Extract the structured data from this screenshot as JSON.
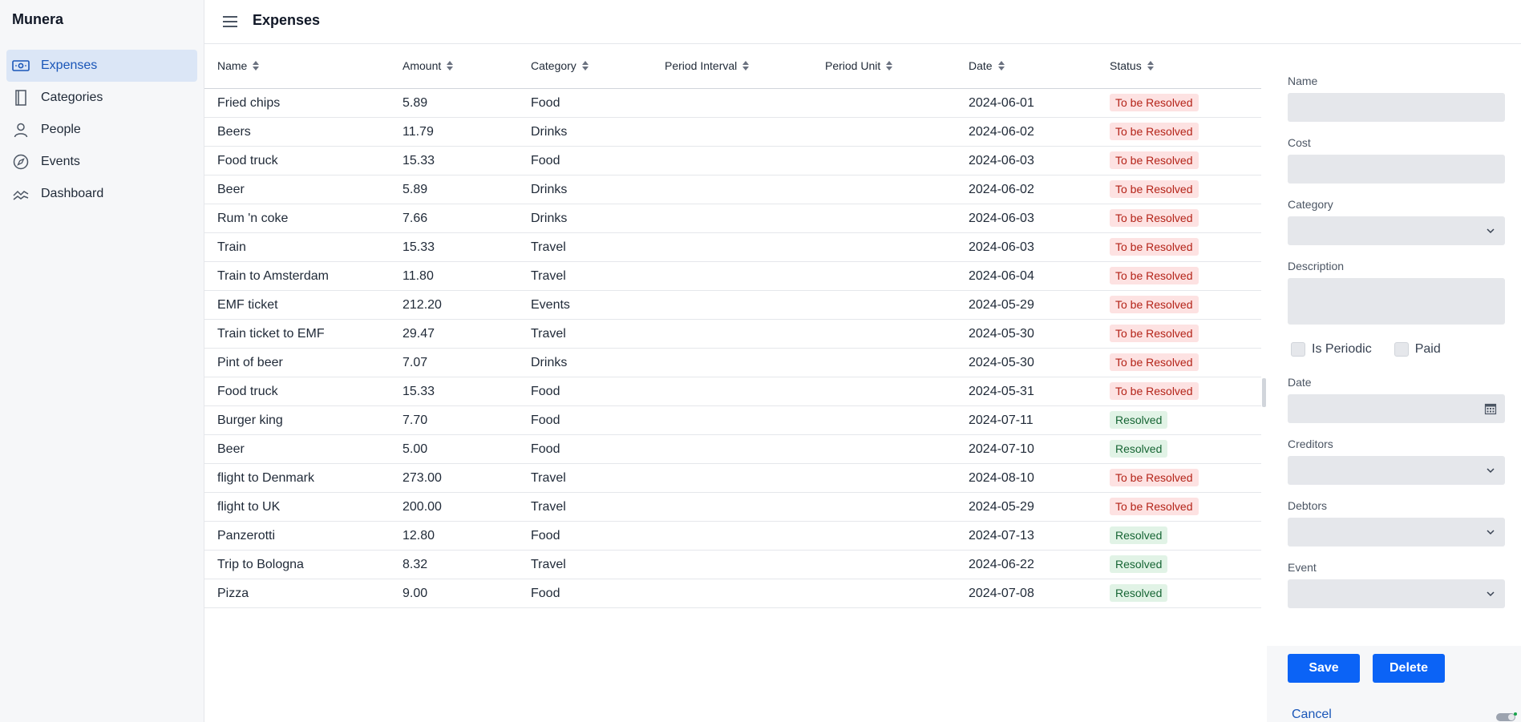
{
  "app": {
    "brand": "Munera"
  },
  "sidebar": {
    "items": [
      {
        "label": "Expenses",
        "icon": "money-icon",
        "active": true
      },
      {
        "label": "Categories",
        "icon": "book-icon",
        "active": false
      },
      {
        "label": "People",
        "icon": "person-icon",
        "active": false
      },
      {
        "label": "Events",
        "icon": "compass-icon",
        "active": false
      },
      {
        "label": "Dashboard",
        "icon": "chart-line-icon",
        "active": false
      }
    ]
  },
  "header": {
    "title": "Expenses",
    "menu_icon": "hamburger-icon"
  },
  "table": {
    "columns": [
      "Name",
      "Amount",
      "Category",
      "Period Interval",
      "Period Unit",
      "Date",
      "Status"
    ],
    "rows": [
      {
        "name": "Fried chips",
        "amount": "5.89",
        "category": "Food",
        "period_interval": "",
        "period_unit": "",
        "date": "2024-06-01",
        "status": "To be Resolved"
      },
      {
        "name": "Beers",
        "amount": "11.79",
        "category": "Drinks",
        "period_interval": "",
        "period_unit": "",
        "date": "2024-06-02",
        "status": "To be Resolved"
      },
      {
        "name": "Food truck",
        "amount": "15.33",
        "category": "Food",
        "period_interval": "",
        "period_unit": "",
        "date": "2024-06-03",
        "status": "To be Resolved"
      },
      {
        "name": "Beer",
        "amount": "5.89",
        "category": "Drinks",
        "period_interval": "",
        "period_unit": "",
        "date": "2024-06-02",
        "status": "To be Resolved"
      },
      {
        "name": "Rum 'n coke",
        "amount": "7.66",
        "category": "Drinks",
        "period_interval": "",
        "period_unit": "",
        "date": "2024-06-03",
        "status": "To be Resolved"
      },
      {
        "name": "Train",
        "amount": "15.33",
        "category": "Travel",
        "period_interval": "",
        "period_unit": "",
        "date": "2024-06-03",
        "status": "To be Resolved"
      },
      {
        "name": "Train to Amsterdam",
        "amount": "11.80",
        "category": "Travel",
        "period_interval": "",
        "period_unit": "",
        "date": "2024-06-04",
        "status": "To be Resolved"
      },
      {
        "name": "EMF ticket",
        "amount": "212.20",
        "category": "Events",
        "period_interval": "",
        "period_unit": "",
        "date": "2024-05-29",
        "status": "To be Resolved"
      },
      {
        "name": "Train ticket to EMF",
        "amount": "29.47",
        "category": "Travel",
        "period_interval": "",
        "period_unit": "",
        "date": "2024-05-30",
        "status": "To be Resolved"
      },
      {
        "name": "Pint of beer",
        "amount": "7.07",
        "category": "Drinks",
        "period_interval": "",
        "period_unit": "",
        "date": "2024-05-30",
        "status": "To be Resolved"
      },
      {
        "name": "Food truck",
        "amount": "15.33",
        "category": "Food",
        "period_interval": "",
        "period_unit": "",
        "date": "2024-05-31",
        "status": "To be Resolved"
      },
      {
        "name": "Burger king",
        "amount": "7.70",
        "category": "Food",
        "period_interval": "",
        "period_unit": "",
        "date": "2024-07-11",
        "status": "Resolved"
      },
      {
        "name": "Beer",
        "amount": "5.00",
        "category": "Food",
        "period_interval": "",
        "period_unit": "",
        "date": "2024-07-10",
        "status": "Resolved"
      },
      {
        "name": "flight to Denmark",
        "amount": "273.00",
        "category": "Travel",
        "period_interval": "",
        "period_unit": "",
        "date": "2024-08-10",
        "status": "To be Resolved"
      },
      {
        "name": "flight to UK",
        "amount": "200.00",
        "category": "Travel",
        "period_interval": "",
        "period_unit": "",
        "date": "2024-05-29",
        "status": "To be Resolved"
      },
      {
        "name": "Panzerotti",
        "amount": "12.80",
        "category": "Food",
        "period_interval": "",
        "period_unit": "",
        "date": "2024-07-13",
        "status": "Resolved"
      },
      {
        "name": "Trip to Bologna",
        "amount": "8.32",
        "category": "Travel",
        "period_interval": "",
        "period_unit": "",
        "date": "2024-06-22",
        "status": "Resolved"
      },
      {
        "name": "Pizza",
        "amount": "9.00",
        "category": "Food",
        "period_interval": "",
        "period_unit": "",
        "date": "2024-07-08",
        "status": "Resolved"
      }
    ]
  },
  "form": {
    "name_label": "Name",
    "name_value": "",
    "cost_label": "Cost",
    "cost_value": "",
    "category_label": "Category",
    "category_value": "",
    "description_label": "Description",
    "description_value": "",
    "is_periodic_label": "Is Periodic",
    "paid_label": "Paid",
    "date_label": "Date",
    "date_value": "",
    "creditors_label": "Creditors",
    "debtors_label": "Debtors",
    "event_label": "Event",
    "save_label": "Save",
    "delete_label": "Delete",
    "cancel_label": "Cancel"
  },
  "colors": {
    "accent": "#0b63f6",
    "active_nav_bg": "#dbe6f6",
    "unresolved_bg": "#fde2e2",
    "unresolved_text": "#b42318",
    "resolved_bg": "#e1f3e6",
    "resolved_text": "#166534"
  }
}
